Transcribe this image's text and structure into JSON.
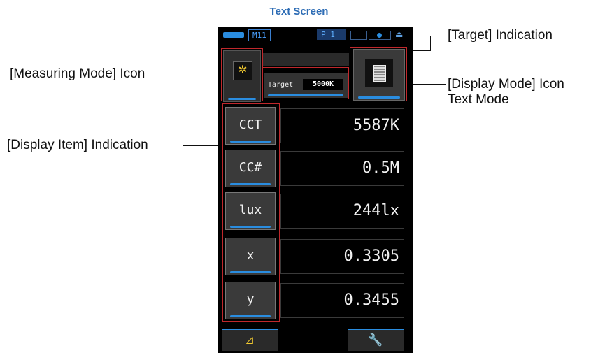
{
  "heading": "Text Screen",
  "callouts": {
    "measuring_mode": "[Measuring Mode] Icon",
    "target": "[Target] Indication",
    "display_mode_line1": "[Display Mode] Icon",
    "display_mode_line2": "Text Mode",
    "display_item": "[Display Item] Indication"
  },
  "status": {
    "memory": "M11",
    "page": "P 1"
  },
  "target": {
    "label": "Target",
    "value": "5000K"
  },
  "rows": [
    {
      "label": "CCT",
      "value": "5587K"
    },
    {
      "label": "CC#",
      "value": "0.5M"
    },
    {
      "label": "lux",
      "value": "244lx"
    },
    {
      "label": "x",
      "value": "0.3305"
    },
    {
      "label": "y",
      "value": "0.3455"
    }
  ],
  "icons": {
    "measuring_mode": "sun-icon",
    "display_mode": "text-mode-icon",
    "bottom_left": "delta-icon",
    "bottom_right": "wrench-icon"
  },
  "colors": {
    "heading": "#2e6db5",
    "highlight_box": "#c0282c",
    "accent": "#2a8de0"
  }
}
